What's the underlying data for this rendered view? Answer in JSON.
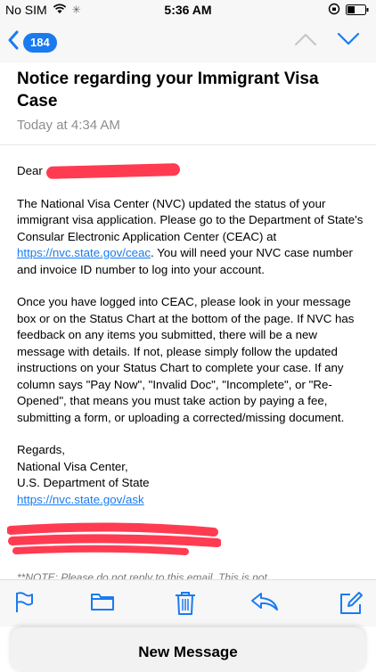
{
  "status_bar": {
    "carrier": "No SIM",
    "time": "5:36 AM"
  },
  "nav": {
    "badge_count": "184"
  },
  "email": {
    "subject": "Notice regarding your Immigrant Visa Case",
    "date": "Today at 4:34 AM",
    "greeting": "Dear",
    "p1_before_link": "The National Visa Center (NVC) updated the status of your immigrant visa application. Please go to the Department of State's Consular Electronic Application Center (CEAC) at ",
    "p1_link": "https://nvc.state.gov/ceac",
    "p1_after_link": ". You will need your NVC case number and invoice ID number to log into your account.",
    "p2": "Once you have logged into CEAC, please look in your message box or on the Status Chart at the bottom of the page. If NVC has feedback on any items you submitted, there will be a new message with details. If not, please simply follow the updated instructions on your Status Chart to complete your case. If any column says \"Pay Now\", \"Invalid Doc\", \"Incomplete\", or \"Re-Opened\", that means you must take action by paying a fee, submitting a form, or uploading a corrected/missing document.",
    "sign_regards": "Regards,",
    "sign_org": "National Visa Center,",
    "sign_dept": "U.S. Department of State",
    "sign_link": "https://nvc.state.gov/ask",
    "note": "**NOTE: Please do not reply to this email. This is not"
  },
  "compose": {
    "label": "New Message"
  },
  "colors": {
    "accent": "#1a7bf0",
    "redaction": "#ff3b52"
  }
}
